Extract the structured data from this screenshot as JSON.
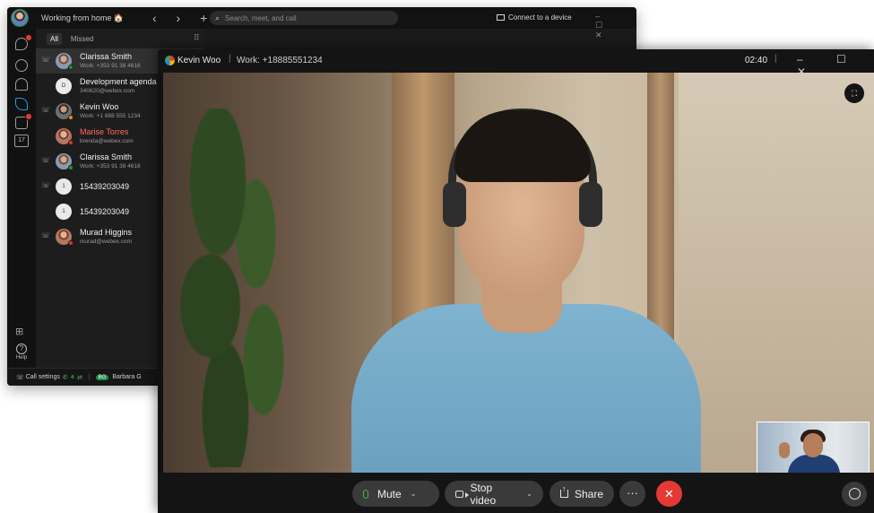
{
  "main": {
    "status": "Working from home 🏠",
    "nav": "‹ › +",
    "search_placeholder": "Search, meet, and call",
    "connect_label": "Connect to a device",
    "window_controls": "– ☐ ✕",
    "tabs": {
      "all": "All",
      "missed": "Missed"
    },
    "calendar_day": "17",
    "help_label": "Help",
    "history": [
      {
        "name": "Clarissa Smith",
        "sub": "Work: +353 91 38 4618",
        "avatar": "photo",
        "call_icon": true,
        "selected": true
      },
      {
        "name": "Development agenda",
        "sub": "340620@webex.com",
        "avatar": "initial",
        "initial": "D",
        "call_icon": false
      },
      {
        "name": "Kevin Woo",
        "sub": "Work: +1 888 555 1234",
        "avatar": "photo2",
        "call_icon": true
      },
      {
        "name": "Marise Torres",
        "sub": "brenda@webex.com",
        "avatar": "photo3",
        "call_icon": false,
        "missed": true
      },
      {
        "name": "Clarissa Smith",
        "sub": "Work: +353 91 38 4618",
        "avatar": "photo",
        "call_icon": true
      },
      {
        "name": "15439203049",
        "sub": "",
        "avatar": "initial",
        "initial": "1",
        "call_icon": true
      },
      {
        "name": "15439203049",
        "sub": "",
        "avatar": "initial",
        "initial": "1",
        "call_icon": false
      },
      {
        "name": "Murad Higgins",
        "sub": "murad@webex.com",
        "avatar": "photo3",
        "call_icon": true
      }
    ],
    "status_bar": {
      "call_settings": "Call settings",
      "user_badge": "BG",
      "user_name": "Barbara G"
    }
  },
  "call": {
    "caller_name": "Kevin Woo",
    "caller_number": "Work: +18885551234",
    "timer": "02:40",
    "window_controls": "– ☐ ✕",
    "controls": {
      "mute": "Mute",
      "stop_video": "Stop video",
      "share": "Share",
      "more": "···",
      "end": "✕"
    }
  },
  "colors": {
    "accent_green": "#3fb950",
    "end_call_red": "#e53935",
    "active_blue": "#16a3e5",
    "missed_red": "#ff6b5e"
  }
}
